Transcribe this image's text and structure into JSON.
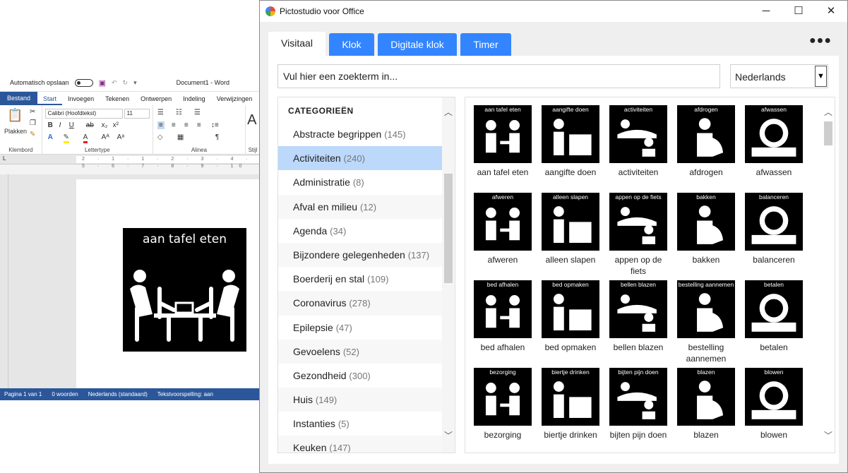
{
  "word": {
    "autosave_label": "Automatisch opslaan",
    "doc_title": "Document1 - Word",
    "tabs": [
      "Bestand",
      "Start",
      "Invoegen",
      "Tekenen",
      "Ontwerpen",
      "Indeling",
      "Verwijzingen"
    ],
    "paste_label": "Plakken",
    "font_name": "Calibri (Hoofdtekst)",
    "font_size": "11",
    "groups": [
      "Klembord",
      "Lettertype",
      "Alinea",
      "Stijl"
    ],
    "ruler_text": "2 · 1 · 1 · 2 · 3 · 4 · 5 · 6 · 7 · 8 · 9 · 10",
    "picto_title": "aan tafel eten",
    "status": [
      "Pagina 1 van 1",
      "0 woorden",
      "Nederlands (standaard)",
      "Tekstvoorspelling: aan"
    ]
  },
  "app": {
    "title": "Pictostudio voor Office",
    "tabs": [
      {
        "label": "Visitaal",
        "selected": true
      },
      {
        "label": "Klok",
        "selected": false
      },
      {
        "label": "Digitale klok",
        "selected": false
      },
      {
        "label": "Timer",
        "selected": false
      }
    ],
    "more_label": "●●●",
    "search_placeholder": "Vul hier een zoekterm in...",
    "language": "Nederlands",
    "categories_header": "CATEGORIEËN",
    "categories": [
      {
        "name": "Abstracte begrippen",
        "count": "(145)",
        "selected": false
      },
      {
        "name": "Activiteiten",
        "count": "(240)",
        "selected": true
      },
      {
        "name": "Administratie",
        "count": "(8)",
        "selected": false
      },
      {
        "name": "Afval en milieu",
        "count": "(12)",
        "selected": false
      },
      {
        "name": "Agenda",
        "count": "(34)",
        "selected": false
      },
      {
        "name": "Bijzondere gelegenheden",
        "count": "(137)",
        "selected": false
      },
      {
        "name": "Boerderij en stal",
        "count": "(109)",
        "selected": false
      },
      {
        "name": "Coronavirus",
        "count": "(278)",
        "selected": false
      },
      {
        "name": "Epilepsie",
        "count": "(47)",
        "selected": false
      },
      {
        "name": "Gevoelens",
        "count": "(52)",
        "selected": false
      },
      {
        "name": "Gezondheid",
        "count": "(300)",
        "selected": false
      },
      {
        "name": "Huis",
        "count": "(149)",
        "selected": false
      },
      {
        "name": "Instanties",
        "count": "(5)",
        "selected": false
      },
      {
        "name": "Keuken",
        "count": "(147)",
        "selected": false
      }
    ],
    "pictos": [
      {
        "tag": "aan tafel eten",
        "label": "aan tafel eten"
      },
      {
        "tag": "aangifte doen",
        "label": "aangifte doen"
      },
      {
        "tag": "activiteiten",
        "label": "activiteiten"
      },
      {
        "tag": "afdrogen",
        "label": "afdrogen"
      },
      {
        "tag": "afwassen",
        "label": "afwassen"
      },
      {
        "tag": "afweren",
        "label": "afweren"
      },
      {
        "tag": "alleen slapen",
        "label": "alleen slapen"
      },
      {
        "tag": "appen op de fiets",
        "label": "appen op de fiets"
      },
      {
        "tag": "bakken",
        "label": "bakken"
      },
      {
        "tag": "balanceren",
        "label": "balanceren"
      },
      {
        "tag": "bed afhalen",
        "label": "bed afhalen"
      },
      {
        "tag": "bed opmaken",
        "label": "bed opmaken"
      },
      {
        "tag": "bellen blazen",
        "label": "bellen blazen"
      },
      {
        "tag": "bestelling aannemen",
        "label": "bestelling aannemen"
      },
      {
        "tag": "betalen",
        "label": "betalen"
      },
      {
        "tag": "bezorging",
        "label": "bezorging"
      },
      {
        "tag": "biertje drinken",
        "label": "biertje drinken"
      },
      {
        "tag": "bijten pijn doen",
        "label": "bijten pijn doen"
      },
      {
        "tag": "blazen",
        "label": "blazen"
      },
      {
        "tag": "blowen",
        "label": "blowen"
      }
    ],
    "accent": "#3385ff",
    "selected_bg": "#bcd8fb"
  }
}
